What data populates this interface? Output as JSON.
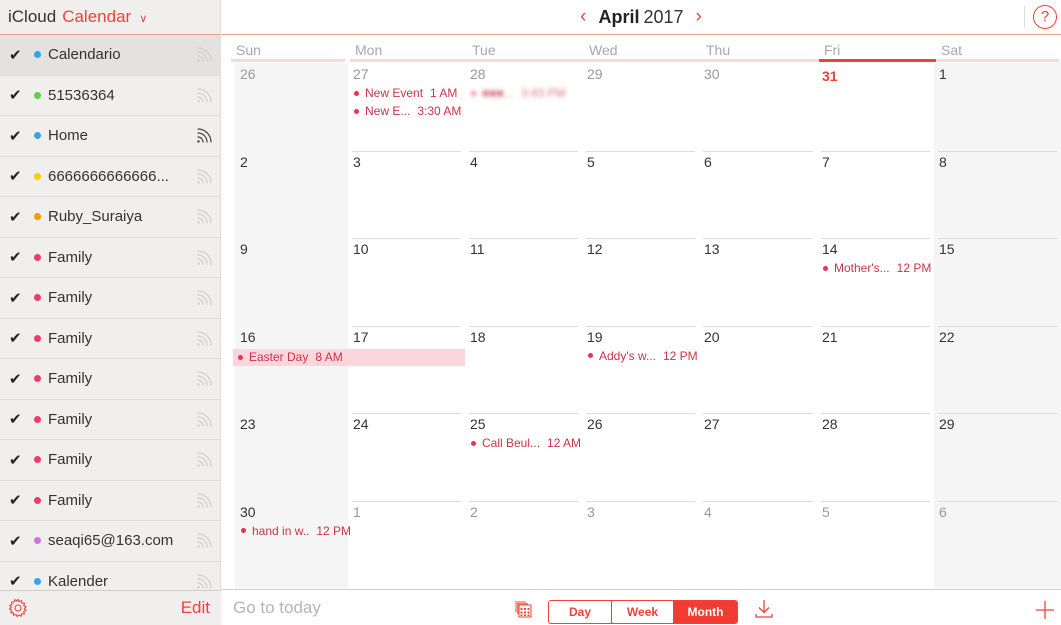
{
  "sidebar": {
    "app_name": "iCloud",
    "app_section": "Calendar",
    "calendars": [
      {
        "name": "Calendario",
        "color": "#2ea8e6",
        "checked": true,
        "selected": true,
        "shared": false
      },
      {
        "name": "51536364",
        "color": "#5dd23c",
        "checked": true,
        "selected": false,
        "shared": false
      },
      {
        "name": "Home",
        "color": "#2ea8e6",
        "checked": true,
        "selected": false,
        "shared": true
      },
      {
        "name": "6666666666666...",
        "color": "#ffcc00",
        "checked": true,
        "selected": false,
        "shared": false
      },
      {
        "name": "Ruby_Suraiya",
        "color": "#ff9500",
        "checked": true,
        "selected": false,
        "shared": false
      },
      {
        "name": "Family",
        "color": "#f23a6a",
        "checked": true,
        "selected": false,
        "shared": false
      },
      {
        "name": "Family",
        "color": "#f23a6a",
        "checked": true,
        "selected": false,
        "shared": false
      },
      {
        "name": "Family",
        "color": "#f23a6a",
        "checked": true,
        "selected": false,
        "shared": false
      },
      {
        "name": "Family",
        "color": "#f23a6a",
        "checked": true,
        "selected": false,
        "shared": false
      },
      {
        "name": "Family",
        "color": "#f23a6a",
        "checked": true,
        "selected": false,
        "shared": false
      },
      {
        "name": "Family",
        "color": "#f23a6a",
        "checked": true,
        "selected": false,
        "shared": false
      },
      {
        "name": "Family",
        "color": "#f23a6a",
        "checked": true,
        "selected": false,
        "shared": false
      },
      {
        "name": "seaqi65@163.com",
        "color": "#cc73e1",
        "checked": true,
        "selected": false,
        "shared": false
      },
      {
        "name": "Kalender",
        "color": "#2ea8e6",
        "checked": true,
        "selected": false,
        "shared": false
      }
    ],
    "edit_label": "Edit"
  },
  "header": {
    "month": "April",
    "year": "2017",
    "prev_icon": "chevron-left-icon",
    "next_icon": "chevron-right-icon",
    "help_label": "?"
  },
  "weekdays": [
    "Sun",
    "Mon",
    "Tue",
    "Wed",
    "Thu",
    "Fri",
    "Sat"
  ],
  "today_weekday_index": 5,
  "weeks": [
    [
      {
        "day": "26",
        "other": true
      },
      {
        "day": "27",
        "other": true,
        "events": [
          {
            "title": "New Event",
            "time": "1 AM"
          },
          {
            "title": "New E...",
            "time": "3:30 AM"
          }
        ]
      },
      {
        "day": "28",
        "other": true,
        "events": [
          {
            "title": "■■■...",
            "time": "3:43 PM",
            "blurred": true
          }
        ]
      },
      {
        "day": "29",
        "other": true
      },
      {
        "day": "30",
        "other": true
      },
      {
        "day": "31",
        "other": true,
        "today": true
      },
      {
        "day": "1"
      }
    ],
    [
      {
        "day": "2"
      },
      {
        "day": "3"
      },
      {
        "day": "4"
      },
      {
        "day": "5"
      },
      {
        "day": "6"
      },
      {
        "day": "7"
      },
      {
        "day": "8"
      }
    ],
    [
      {
        "day": "9"
      },
      {
        "day": "10"
      },
      {
        "day": "11"
      },
      {
        "day": "12"
      },
      {
        "day": "13"
      },
      {
        "day": "14",
        "events": [
          {
            "title": "Mother's...",
            "time": "12 PM"
          }
        ]
      },
      {
        "day": "15"
      }
    ],
    [
      {
        "day": "16"
      },
      {
        "day": "17"
      },
      {
        "day": "18"
      },
      {
        "day": "19",
        "events": [
          {
            "title": "Addy's w...",
            "time": "12 PM"
          }
        ]
      },
      {
        "day": "20"
      },
      {
        "day": "21"
      },
      {
        "day": "22"
      }
    ],
    [
      {
        "day": "23"
      },
      {
        "day": "24"
      },
      {
        "day": "25",
        "events": [
          {
            "title": "Call Beul...",
            "time": "12 AM"
          }
        ]
      },
      {
        "day": "26"
      },
      {
        "day": "27"
      },
      {
        "day": "28"
      },
      {
        "day": "29"
      }
    ],
    [
      {
        "day": "30",
        "events": [
          {
            "title": "hand in w..",
            "time": "12 PM"
          }
        ]
      },
      {
        "day": "1",
        "other": true
      },
      {
        "day": "2",
        "other": true
      },
      {
        "day": "3",
        "other": true
      },
      {
        "day": "4",
        "other": true
      },
      {
        "day": "5",
        "other": true
      },
      {
        "day": "6",
        "other": true
      }
    ]
  ],
  "multiday_events": [
    {
      "title": "Easter Day",
      "time": "8 AM",
      "week": 3,
      "start_col": 0,
      "span": 2
    }
  ],
  "bottombar": {
    "go_to_today": "Go to today",
    "views": [
      "Day",
      "Week",
      "Month"
    ],
    "active_view": "Month"
  },
  "colors": {
    "accent": "#f2403a",
    "event_text": "#c9344a",
    "event_dot": "#f2304f",
    "allday_bg": "#fcd6dc",
    "weekend_bg": "#f5f5f5"
  }
}
